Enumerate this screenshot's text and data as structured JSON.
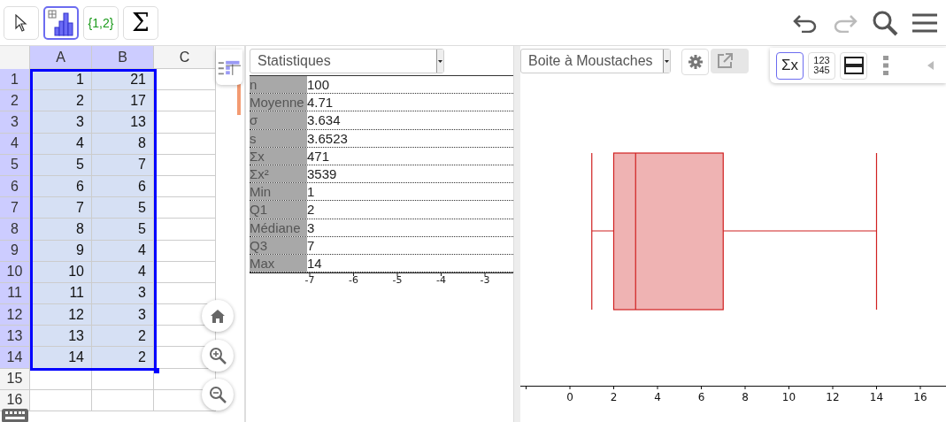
{
  "toolbar": {
    "tools": [
      {
        "kind": "pointer",
        "selected": false
      },
      {
        "kind": "chart",
        "selected": true
      },
      {
        "kind": "list",
        "label": "{1,2}",
        "selected": false
      },
      {
        "kind": "sum",
        "label": "Σ",
        "selected": false
      }
    ],
    "actions": [
      {
        "kind": "undo",
        "disabled": false
      },
      {
        "kind": "redo",
        "disabled": true
      },
      {
        "kind": "search",
        "disabled": false
      },
      {
        "kind": "menu",
        "disabled": false
      }
    ]
  },
  "spreadsheet": {
    "columns": [
      {
        "label": "A",
        "selected": true
      },
      {
        "label": "B",
        "selected": true
      },
      {
        "label": "C",
        "selected": false
      }
    ],
    "rows": [
      {
        "header": "1",
        "cells": [
          "1",
          "21"
        ],
        "selected": true
      },
      {
        "header": "2",
        "cells": [
          "2",
          "17"
        ],
        "selected": true
      },
      {
        "header": "3",
        "cells": [
          "3",
          "13"
        ],
        "selected": true
      },
      {
        "header": "4",
        "cells": [
          "4",
          "8"
        ],
        "selected": true
      },
      {
        "header": "5",
        "cells": [
          "5",
          "7"
        ],
        "selected": true
      },
      {
        "header": "6",
        "cells": [
          "6",
          "6"
        ],
        "selected": true
      },
      {
        "header": "7",
        "cells": [
          "7",
          "5"
        ],
        "selected": true
      },
      {
        "header": "8",
        "cells": [
          "8",
          "5"
        ],
        "selected": true
      },
      {
        "header": "9",
        "cells": [
          "9",
          "4"
        ],
        "selected": true
      },
      {
        "header": "10",
        "cells": [
          "10",
          "4"
        ],
        "selected": true
      },
      {
        "header": "11",
        "cells": [
          "11",
          "3"
        ],
        "selected": true
      },
      {
        "header": "12",
        "cells": [
          "12",
          "3"
        ],
        "selected": true
      },
      {
        "header": "13",
        "cells": [
          "13",
          "2"
        ],
        "selected": true
      },
      {
        "header": "14",
        "cells": [
          "14",
          "2"
        ],
        "selected": true
      },
      {
        "header": "15",
        "cells": [],
        "selected": false
      },
      {
        "header": "16",
        "cells": [],
        "selected": false
      }
    ]
  },
  "statistics": {
    "dropdown": "Statistiques",
    "rows": [
      {
        "label": "n",
        "value": "100"
      },
      {
        "label": "Moyenne",
        "value": "4.71"
      },
      {
        "label": "σ",
        "value": "3.634"
      },
      {
        "label": "s",
        "value": "3.6523"
      },
      {
        "label": "Σx",
        "value": "471"
      },
      {
        "label": "Σx²",
        "value": "3539"
      },
      {
        "label": "Min",
        "value": "1"
      },
      {
        "label": "Q1",
        "value": "2"
      },
      {
        "label": "Médiane",
        "value": "3"
      },
      {
        "label": "Q3",
        "value": "7"
      },
      {
        "label": "Max",
        "value": "14"
      }
    ],
    "axis_labels": [
      "-7",
      "-6",
      "-5",
      "-4",
      "-3"
    ]
  },
  "graph": {
    "dropdown": "Boite à Moustaches",
    "tools": [
      {
        "kind": "text",
        "label": "Σx",
        "selected": true
      },
      {
        "kind": "numbers",
        "lines": [
          "123",
          "345"
        ],
        "selected": false
      },
      {
        "kind": "layout",
        "selected": false
      }
    ],
    "axis_labels": [
      "0",
      "2",
      "4",
      "6",
      "8",
      "10",
      "12",
      "14",
      "16"
    ]
  }
}
